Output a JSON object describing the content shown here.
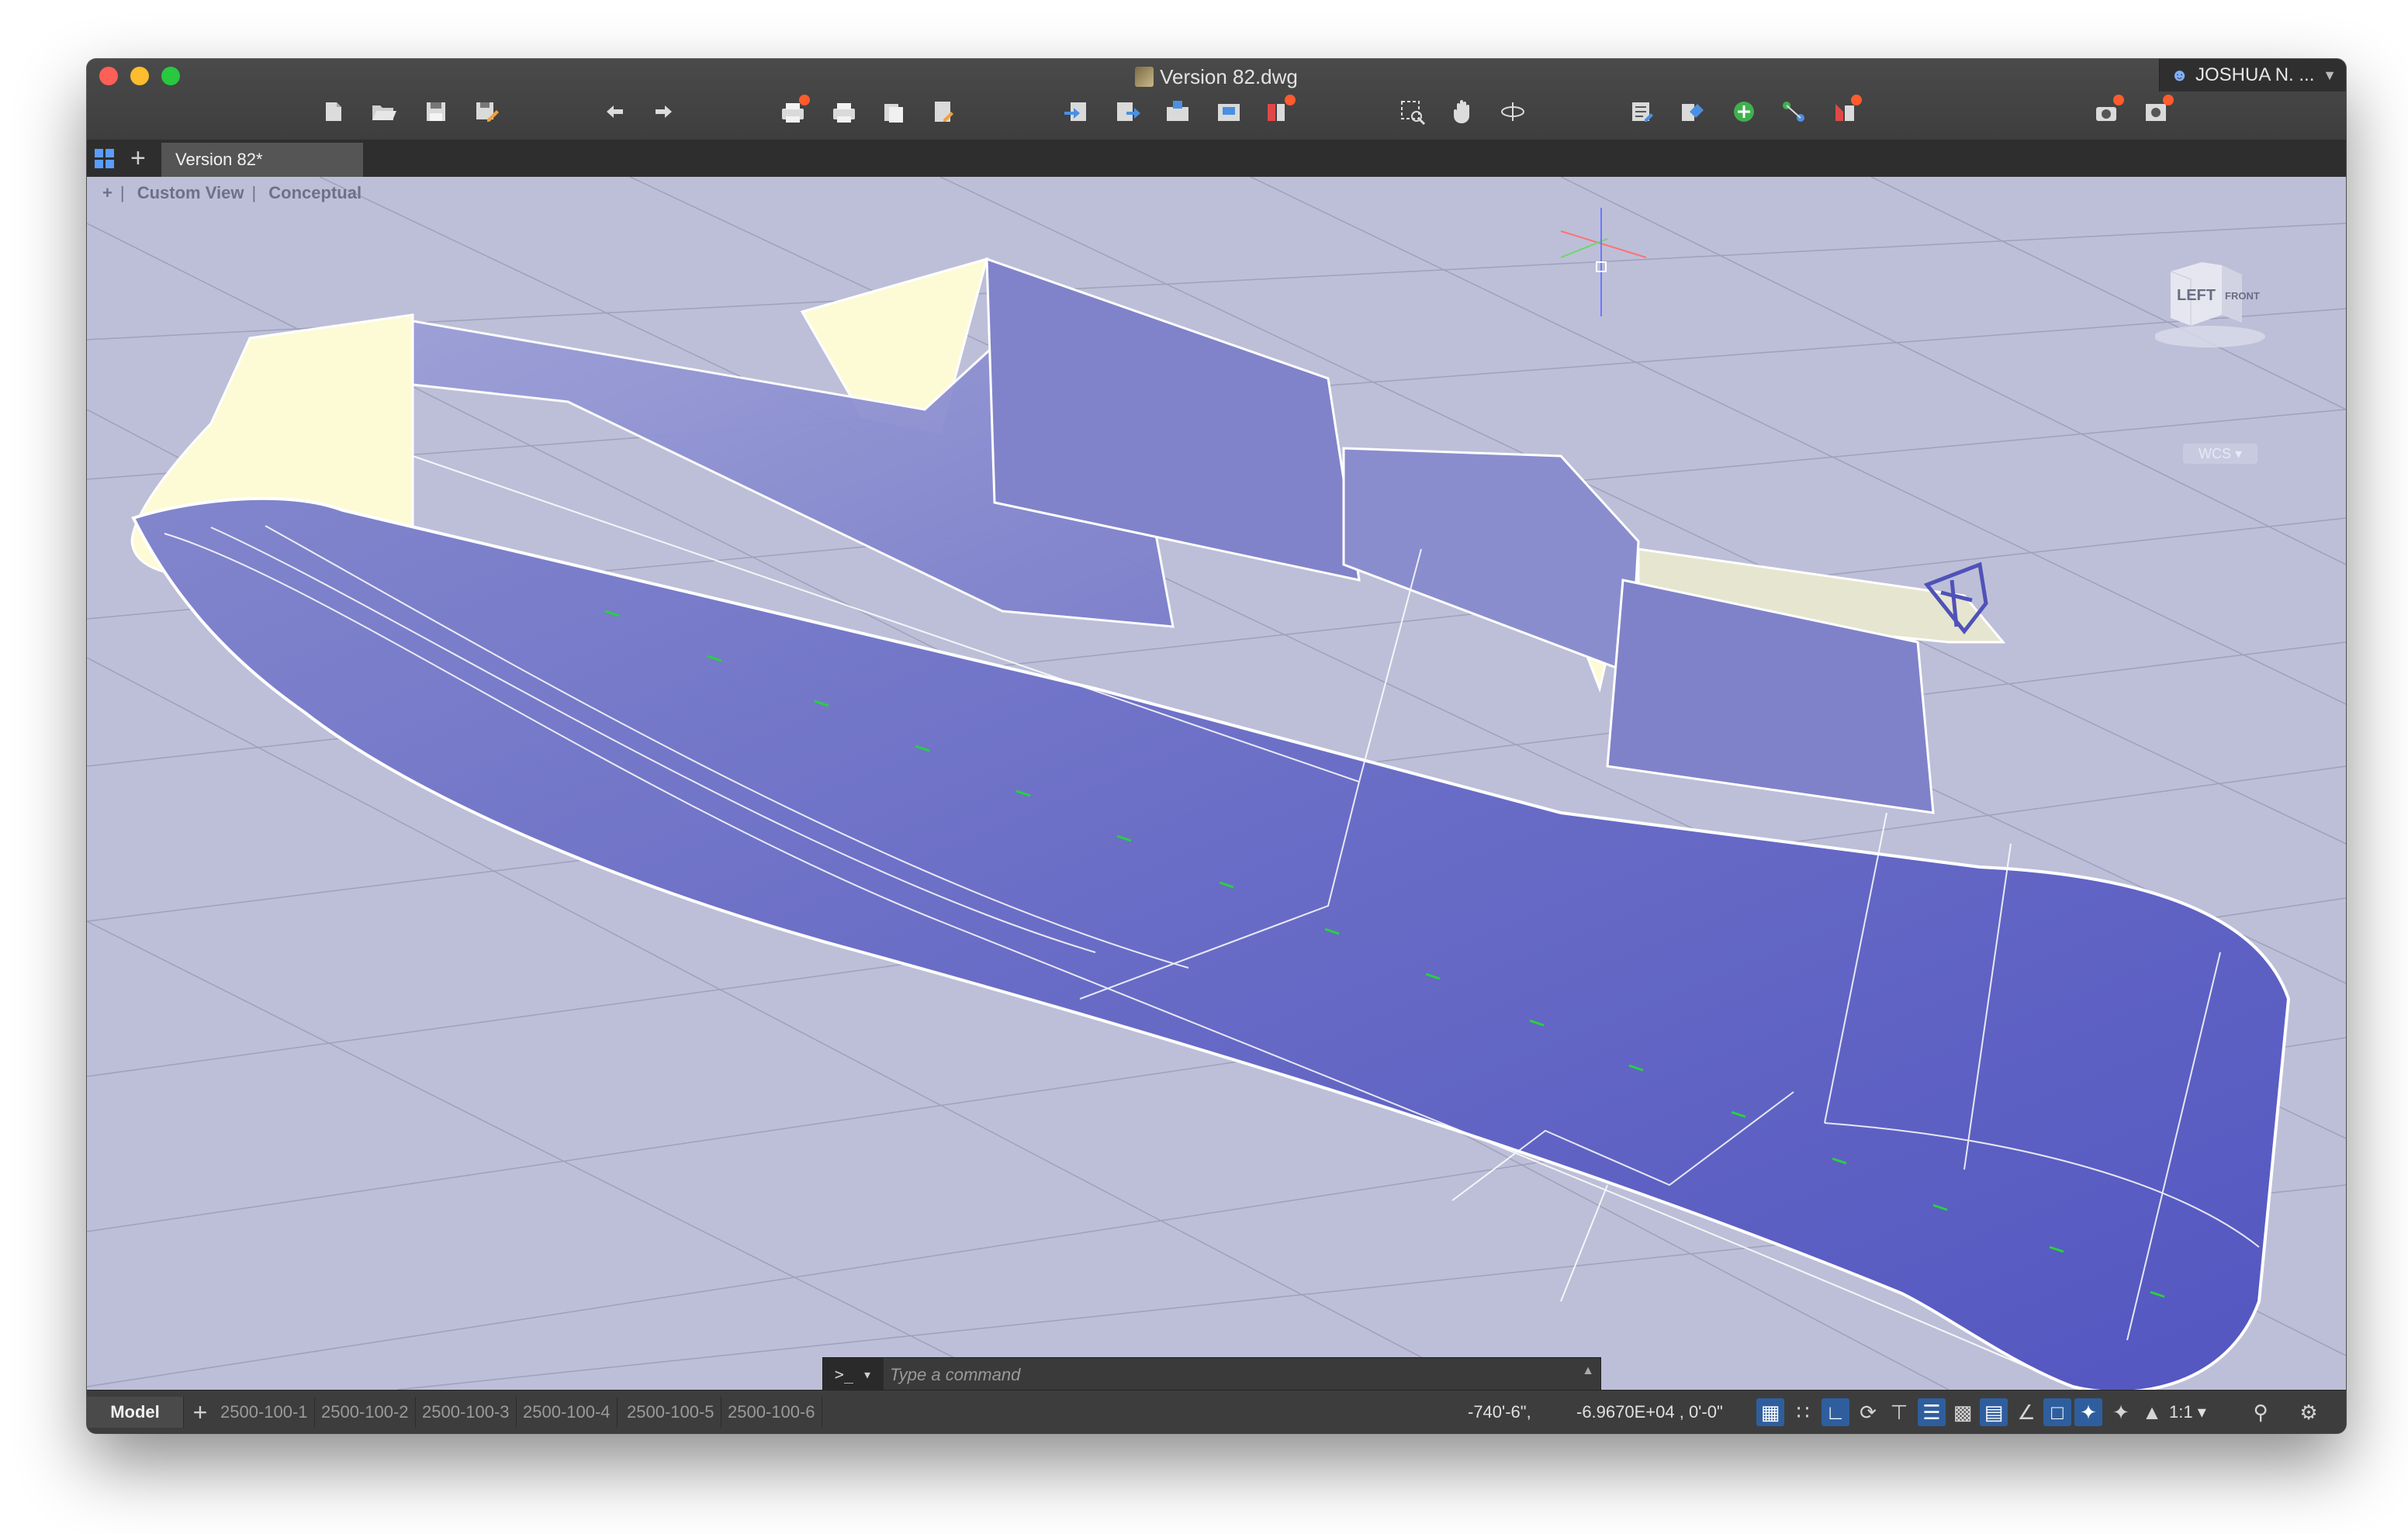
{
  "window": {
    "title": "Version 82.dwg",
    "user_name": "JOSHUA N. ..."
  },
  "toolbar": {
    "groups": [
      [
        "new-icon",
        "open-icon",
        "save-icon",
        "save-as-icon"
      ],
      [
        "undo-icon",
        "redo-icon"
      ],
      [
        "plot-icon",
        "print-icon",
        "publish-icon",
        "page-setup-icon"
      ],
      [
        "import-icon",
        "export-icon",
        "attach-icon",
        "xref-icon",
        "layers-icon"
      ],
      [
        "zoom-window-icon",
        "pan-hand-icon",
        "orbit-icon"
      ],
      [
        "properties-icon",
        "block-icon",
        "add-icon",
        "connect-icon",
        "measure-icon"
      ],
      [
        "render-icon",
        "settings-icon"
      ]
    ]
  },
  "tabs": {
    "active_label": "Version 82*"
  },
  "viewport": {
    "controls": [
      "+",
      "Custom View",
      "Conceptual"
    ],
    "viewcube": {
      "left_face": "LEFT",
      "front_face": "FRONT"
    },
    "wcs_label": "WCS",
    "colors": {
      "background": "#bdbfd8",
      "hull_fill": "#6060c4",
      "deck_fill": "#fdfbd6",
      "grid_line": "#9c9eb8",
      "edge": "#ffffff",
      "station_mark": "#28d23c"
    }
  },
  "command": {
    "prompt_symbol": ">_",
    "placeholder": "Type a command"
  },
  "status": {
    "model_tab": "Model",
    "layouts": [
      "2500-100-1",
      "2500-100-2",
      "2500-100-3",
      "2500-100-4",
      "2500-100-5",
      "2500-100-6"
    ],
    "coord_x": "-740'-6\",",
    "coord_yz": "-6.9670E+04 , 0'-0\"",
    "scale": "1:1",
    "toggle_icons": [
      "grid-display-icon",
      "snap-mode-icon",
      "ortho-icon",
      "polar-tracking-icon",
      "object-snap-icon",
      "lineweight-icon",
      "transparency-icon",
      "selection-cycling-icon",
      "dynamic-ucs-icon",
      "annotation-icon",
      "anno-visibility-icon",
      "auto-scale-icon",
      "annotation-scale-icon",
      "workspace-icon",
      "customize-icon"
    ]
  }
}
